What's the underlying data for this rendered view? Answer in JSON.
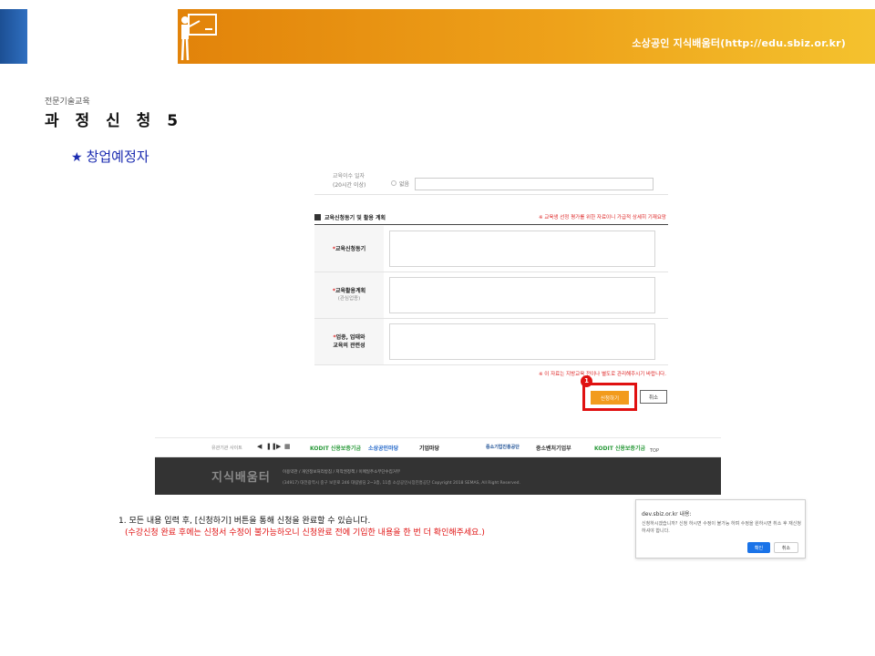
{
  "header": {
    "site_name": "소상공인 지식배움터(http://edu.sbiz.or.kr)",
    "colors": {
      "orange": "#e2830a",
      "yellow": "#f4c22e",
      "blue": "#1c4f94"
    },
    "icon": "teacher-blackboard-icon"
  },
  "page": {
    "breadcrumb": "전문기술교육",
    "title": "과 정 신 청 5",
    "section_star": "★",
    "section": "창업예정자"
  },
  "form": {
    "top_row_cut": "교육이수 일자",
    "top_row_label": "(20시간 이상)",
    "top_row_radio": "없음",
    "section_title": "교육신청동기 및 활용 계획",
    "section_note": "※ 교육생 선정 평가를 위한 자료이니 가급적 상세히 기재요망",
    "rows": [
      {
        "label": "교육신청동기",
        "sub": ""
      },
      {
        "label": "교육활용계획",
        "sub": "(관심업종)"
      },
      {
        "label": "업종, 업태와",
        "label2": "교육의 관련성",
        "sub": ""
      }
    ],
    "required_mark": "*",
    "footer_note": "※ 이 자료는 지방교육 전이나 별도로 관리해주시기 바랍니다.",
    "badge": "1",
    "apply_label": "신청하기",
    "cancel_label": "취소"
  },
  "site_footer": {
    "partner_label": "유관기관 사이트",
    "controls": [
      "◀",
      "❚❚",
      "▶",
      "▦"
    ],
    "partners": [
      "KODIT 신용보증기금",
      "소상공인마당",
      "기업마당",
      "중소기업진흥공단",
      "중소벤처기업부",
      "KODIT 신용보증기금"
    ],
    "top_label": "TOP",
    "logo": "지식배움터",
    "links": "이용약관 / 개인정보처리방침 / 저작권정책 / 이메일주소무단수집거부",
    "address": "(34917) 대전광역시 중구 보문로 246 대림빌딩 2~3층, 11층 소상공인시장진흥공단 Copyright 2018 SEMAS, All Right Reserved."
  },
  "instructions": {
    "line1": "1. 모든 내용 입력 후, [신청하기] 버튼을 통해 신청을 완료할 수 있습니다.",
    "line2": "(수강신청 완료 후에는 신청서 수정이 불가능하오니 신청완료 전에 기입한 내용을 한 번 더 확인해주세요.)"
  },
  "dialog": {
    "title": "dev.sbiz.or.kr 내용:",
    "message": "신청하시겠습니까? 신청 하시면 수정이 불가능 하며 수정을 원하시면 취소 후 재신청 하셔야 합니다.",
    "ok_label": "확인",
    "cancel_label": "취소"
  }
}
